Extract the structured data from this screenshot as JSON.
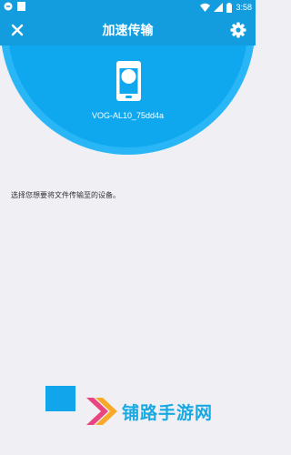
{
  "status_bar": {
    "time": "3:58",
    "background": "#139ddf",
    "icons": [
      "notification-icon",
      "square-icon",
      "wifi-icon",
      "signal-icon",
      "battery-icon"
    ]
  },
  "toolbar": {
    "title": "加速传输",
    "background": "#139ddf",
    "left_icon": "close-icon",
    "right_icon": "gear-icon"
  },
  "device": {
    "name": "VOG-AL10_75dd4a",
    "icon": "phone-icon",
    "circle_color": "#29b6f6"
  },
  "hint": "选择您想要将文件传输至的设备。",
  "watermark": {
    "text": "铺路手游网",
    "logo": "arrow-logo-icon",
    "color": "#19a9e2"
  }
}
